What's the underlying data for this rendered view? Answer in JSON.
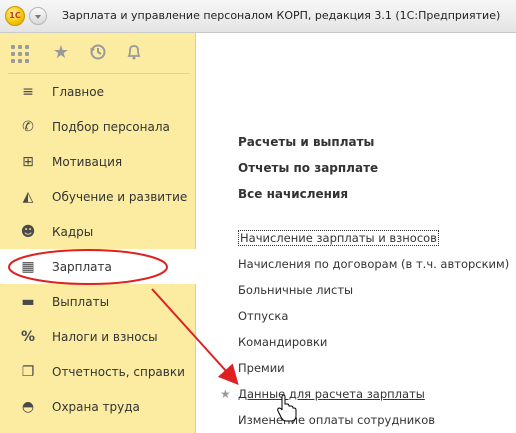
{
  "window": {
    "app_logo": "1С",
    "title": "Зарплата и управление персоналом КОРП, редакция 3.1  (1С:Предприятие)"
  },
  "toolbar": {
    "icons": [
      "apps-grid-icon",
      "star-icon",
      "history-icon",
      "bell-icon"
    ]
  },
  "sidebar": {
    "items": [
      {
        "label": "Главное",
        "icon": "menu-lines-icon",
        "glyph": "≡",
        "active": false
      },
      {
        "label": "Подбор персонала",
        "icon": "phone-icon",
        "glyph": "✆",
        "active": false
      },
      {
        "label": "Мотивация",
        "icon": "gift-icon",
        "glyph": "⊞",
        "active": false
      },
      {
        "label": "Обучение и развитие",
        "icon": "graduation-cap-icon",
        "glyph": "◭",
        "active": false
      },
      {
        "label": "Кадры",
        "icon": "people-icon",
        "glyph": "☻",
        "active": false
      },
      {
        "label": "Зарплата",
        "icon": "calculator-icon",
        "glyph": "▦",
        "active": true
      },
      {
        "label": "Выплаты",
        "icon": "wallet-icon",
        "glyph": "▬",
        "active": false
      },
      {
        "label": "Налоги и взносы",
        "icon": "percent-icon",
        "glyph": "%",
        "active": false
      },
      {
        "label": "Отчетность, справки",
        "icon": "documents-icon",
        "glyph": "❐",
        "active": false
      },
      {
        "label": "Охрана труда",
        "icon": "hard-hat-icon",
        "glyph": "◓",
        "active": false
      }
    ]
  },
  "main": {
    "sections": [
      "Расчеты и выплаты",
      "Отчеты по зарплате",
      "Все начисления"
    ],
    "links": [
      {
        "label": "Начисление зарплаты и взносов",
        "state": "focused"
      },
      {
        "label": "Начисления по договорам (в т.ч. авторским)",
        "state": ""
      },
      {
        "label": "Больничные листы",
        "state": ""
      },
      {
        "label": "Отпуска",
        "state": ""
      },
      {
        "label": "Командировки",
        "state": ""
      },
      {
        "label": "Премии",
        "state": ""
      },
      {
        "label": "Данные для расчета зарплаты",
        "state": "hovered",
        "favorite": true
      },
      {
        "label": "Изменение оплаты сотрудников",
        "state": ""
      }
    ]
  },
  "annotation": {
    "color": "#e02020"
  },
  "colors": {
    "sidebar_bg": "#fbeca1",
    "active_item_bg": "#ffffff",
    "annotation": "#e02020"
  }
}
